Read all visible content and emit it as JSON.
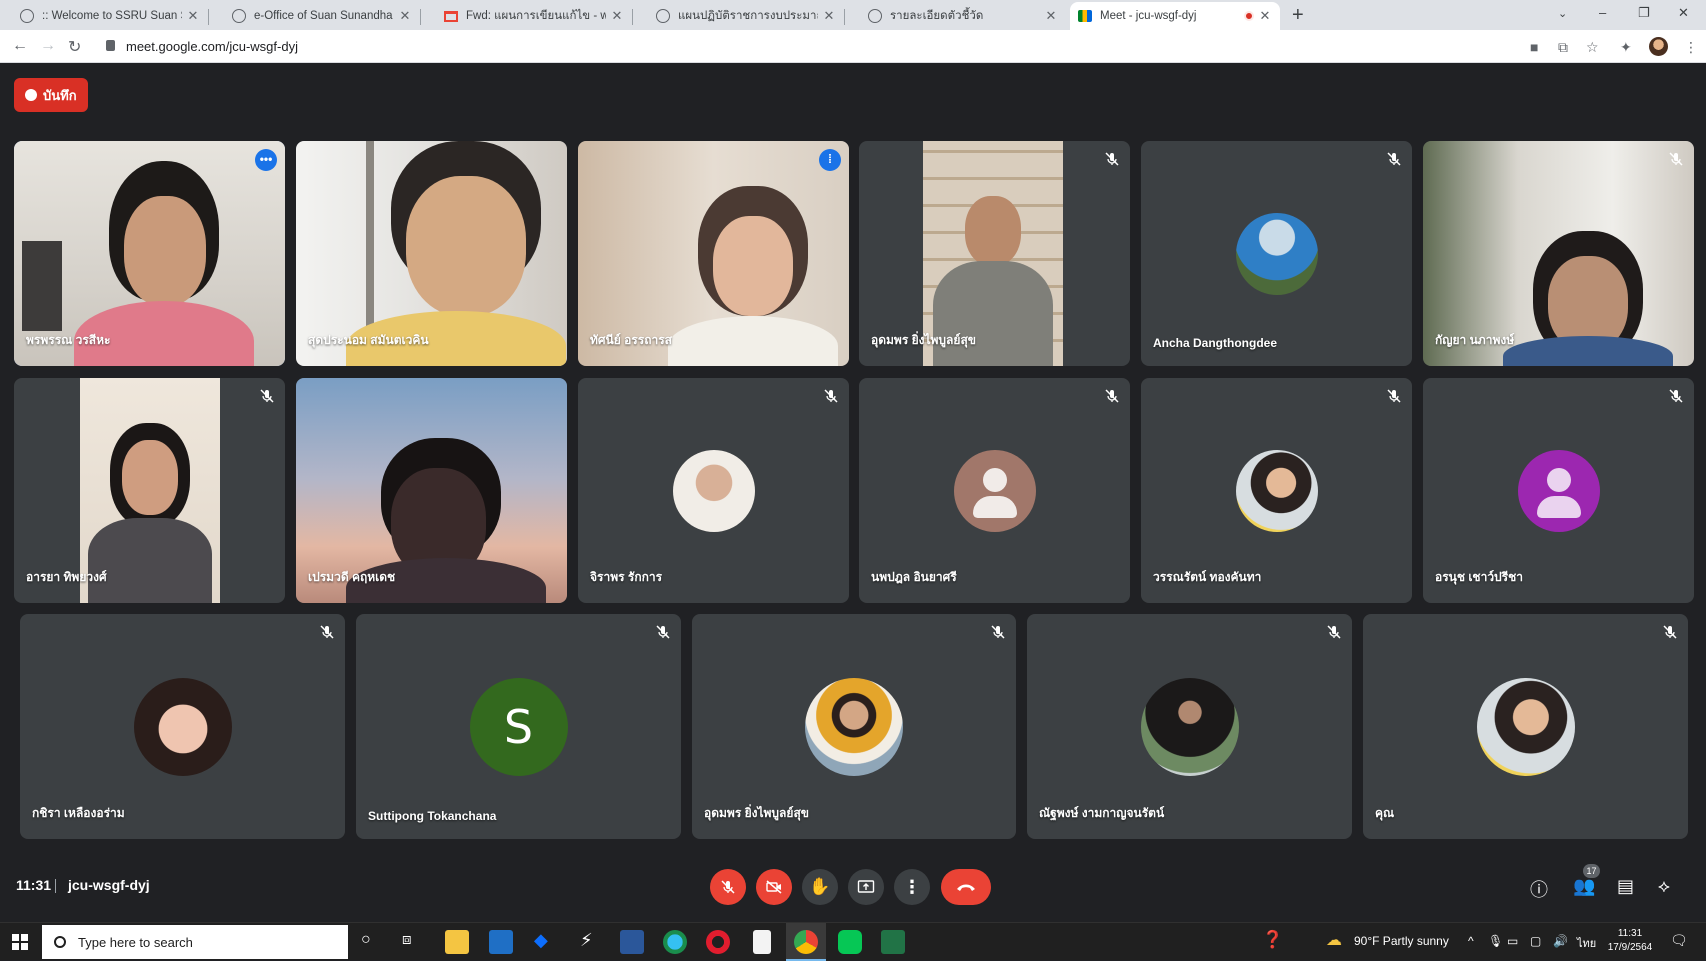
{
  "browser": {
    "tabs": [
      {
        "title": ":: Welcome to SSRU Suan Sunand",
        "icon": "globe-icon"
      },
      {
        "title": "e-Office of Suan Sunandha Rajab",
        "icon": "globe-icon"
      },
      {
        "title": "Fwd: แผนการเขียนแก้ไข - wannarat",
        "icon": "gmail-icon"
      },
      {
        "title": "แผนปฏิบัติราชการงบประมาณ มหาวิท",
        "icon": "globe-icon"
      },
      {
        "title": "รายละเอียดตัวชี้วัด",
        "icon": "globe-icon"
      },
      {
        "title": "Meet - jcu-wsgf-dyj",
        "icon": "meet-icon",
        "active": true,
        "recording": true
      }
    ],
    "url": "meet.google.com/jcu-wsgf-dyj"
  },
  "meet": {
    "record_label": "บันทึก",
    "participants": [
      {
        "name": "พรพรรณ วรสีหะ",
        "active": true,
        "badge": "•••",
        "kind": "video"
      },
      {
        "name": "สุดประนอม สมันตเวคิน",
        "kind": "video"
      },
      {
        "name": "ทัศนีย์ อรรถารส",
        "kind": "video",
        "speaking": true
      },
      {
        "name": "อุดมพร ยิ่งไพบูลย์สุข",
        "kind": "video",
        "muted": true
      },
      {
        "name": "Ancha Dangthongdee",
        "kind": "avatar-photo",
        "muted": true
      },
      {
        "name": "กัญยา นภาพงษ์",
        "kind": "video",
        "muted": true
      },
      {
        "name": "อารยา ทิพยวงศ์",
        "kind": "video",
        "muted": true
      },
      {
        "name": "เปรมวดี คฤหเดช",
        "kind": "video"
      },
      {
        "name": "จิราพร รักการ",
        "kind": "avatar-photo",
        "muted": true
      },
      {
        "name": "นพปฎล อินยาศรี",
        "kind": "avatar-default",
        "muted": true
      },
      {
        "name": "วรรณรัตน์ ทองคันทา",
        "kind": "avatar-photo",
        "muted": true
      },
      {
        "name": "อรนุช เชาว์ปรีชา",
        "kind": "avatar-default-purple",
        "muted": true
      },
      {
        "name": "กชิรา เหลืองอร่าม",
        "kind": "avatar-photo",
        "muted": true
      },
      {
        "name": "Suttipong Tokanchana",
        "kind": "avatar-letter",
        "letter": "S",
        "muted": true
      },
      {
        "name": "อุดมพร ยิ่งไพบูลย์สุข",
        "kind": "avatar-photo",
        "muted": true
      },
      {
        "name": "ณัฐพงษ์ งามกาญจนรัตน์",
        "kind": "avatar-photo",
        "muted": true
      },
      {
        "name": "คุณ",
        "kind": "avatar-photo",
        "muted": true
      }
    ],
    "meeting_time": "11:31",
    "meeting_code": "jcu-wsgf-dyj",
    "participant_count": "17",
    "colors": {
      "accent": "#8ab4f8",
      "danger": "#ea4335",
      "tile": "#3c4043",
      "background": "#202124"
    }
  },
  "taskbar": {
    "search_placeholder": "Type here to search",
    "weather": "90°F  Partly sunny",
    "language": "ไทย",
    "clock_time": "11:31",
    "clock_date": "17/9/2564"
  }
}
